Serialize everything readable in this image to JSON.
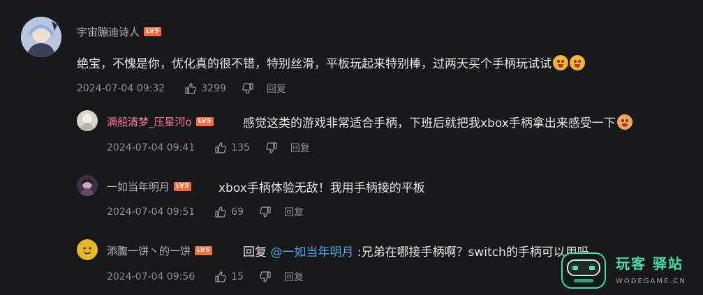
{
  "comments": [
    {
      "user": "宇宙蹦迪诗人",
      "level": "LV5",
      "text": "绝宝，不愧是你，优化真的很不错，特别丝滑，平板玩起来特别棒，过两天买个手柄玩试试",
      "emojis": [
        "scared-face-emoji",
        "scared-face-emoji"
      ],
      "time": "2024-07-04 09:32",
      "likes": "3299",
      "reply_label": "回复"
    },
    {
      "user": "满船清梦_压星河o",
      "level": "LV5",
      "text": "感觉这类的游戏非常适合手柄，下班后就把我xbox手柄拿出来感受一下",
      "emojis": [
        "blush-face-emoji"
      ],
      "time": "2024-07-04 09:41",
      "likes": "135",
      "reply_label": "回复"
    },
    {
      "user": "一如当年明月",
      "level": "LV5",
      "text": "xbox手柄体验无敌！我用手柄接的平板",
      "time": "2024-07-04 09:51",
      "likes": "69",
      "reply_label": "回复"
    },
    {
      "user": "添腹一饼丶的一饼",
      "level": "LV5",
      "reply_prefix": "回复 ",
      "mention": "@一如当年明月",
      "text": " :兄弟在哪接手柄啊？switch的手柄可以用吗",
      "time": "2024-07-04 09:56",
      "likes": "15",
      "reply_label": "回复"
    }
  ],
  "watermark": {
    "title": "玩客 驿站",
    "url": "WODEGAME.CN"
  },
  "colors": {
    "background": "#17181a",
    "username_highlight": "#fb7299",
    "mention": "#4aa5e0",
    "level_badge": "#ff6a3d"
  }
}
